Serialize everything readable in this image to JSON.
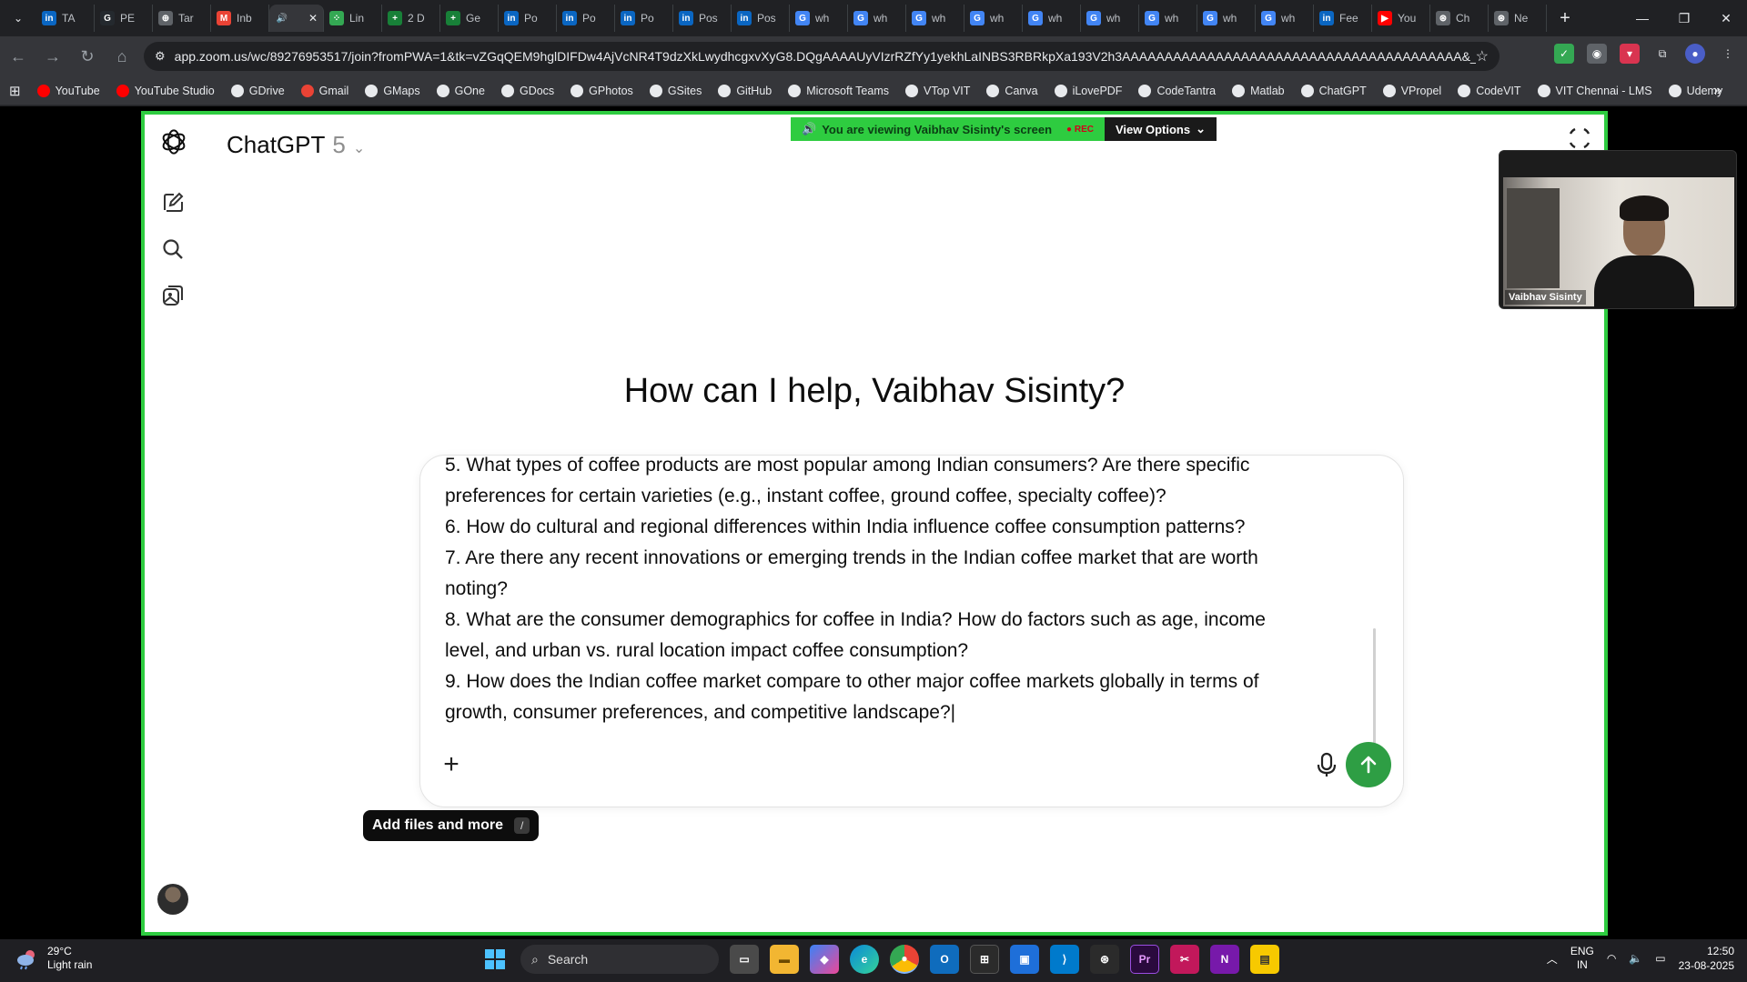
{
  "browser": {
    "tabs": [
      {
        "label": "TA",
        "icon": "linkedin-icon",
        "color": "#0a66c2",
        "glyph": "in"
      },
      {
        "label": "PE",
        "icon": "github-icon",
        "color": "#24292e",
        "glyph": "G"
      },
      {
        "label": "Tar",
        "icon": "globe-icon",
        "color": "#5f6368",
        "glyph": "⊕"
      },
      {
        "label": "Inb",
        "icon": "gmail-icon",
        "color": "#ea4335",
        "glyph": "M"
      },
      {
        "label": "",
        "icon": "audio-icon",
        "color": "#35363a",
        "glyph": "🔊",
        "active": true
      },
      {
        "label": "Lin",
        "icon": "grid-icon",
        "color": "#34a853",
        "glyph": "⁘"
      },
      {
        "label": "2 D",
        "icon": "sheets-icon",
        "color": "#188038",
        "glyph": "+"
      },
      {
        "label": "Ge",
        "icon": "sheets-icon",
        "color": "#188038",
        "glyph": "+"
      },
      {
        "label": "Po",
        "icon": "linkedin-icon",
        "color": "#0a66c2",
        "glyph": "in"
      },
      {
        "label": "Po",
        "icon": "linkedin-icon",
        "color": "#0a66c2",
        "glyph": "in"
      },
      {
        "label": "Po",
        "icon": "linkedin-icon",
        "color": "#0a66c2",
        "glyph": "in"
      },
      {
        "label": "Pos",
        "icon": "linkedin-icon",
        "color": "#0a66c2",
        "glyph": "in"
      },
      {
        "label": "Pos",
        "icon": "linkedin-icon",
        "color": "#0a66c2",
        "glyph": "in"
      },
      {
        "label": "wh",
        "icon": "google-icon",
        "color": "#4285f4",
        "glyph": "G"
      },
      {
        "label": "wh",
        "icon": "google-icon",
        "color": "#4285f4",
        "glyph": "G"
      },
      {
        "label": "wh",
        "icon": "google-icon",
        "color": "#4285f4",
        "glyph": "G"
      },
      {
        "label": "wh",
        "icon": "google-icon",
        "color": "#4285f4",
        "glyph": "G"
      },
      {
        "label": "wh",
        "icon": "google-icon",
        "color": "#4285f4",
        "glyph": "G"
      },
      {
        "label": "wh",
        "icon": "google-icon",
        "color": "#4285f4",
        "glyph": "G"
      },
      {
        "label": "wh",
        "icon": "google-icon",
        "color": "#4285f4",
        "glyph": "G"
      },
      {
        "label": "wh",
        "icon": "google-icon",
        "color": "#4285f4",
        "glyph": "G"
      },
      {
        "label": "wh",
        "icon": "google-icon",
        "color": "#4285f4",
        "glyph": "G"
      },
      {
        "label": "Fee",
        "icon": "linkedin-icon",
        "color": "#0a66c2",
        "glyph": "in"
      },
      {
        "label": "You",
        "icon": "youtube-icon",
        "color": "#ff0000",
        "glyph": "▶"
      },
      {
        "label": "Ch",
        "icon": "chatgpt-icon",
        "color": "#5f6368",
        "glyph": "⊛"
      },
      {
        "label": "Ne",
        "icon": "chatgpt-icon",
        "color": "#5f6368",
        "glyph": "⊛"
      }
    ],
    "url": "app.zoom.us/wc/89276953517/join?fromPWA=1&tk=vZGqQEM9hglDIFDw4AjVcNR4T9dzXkLwydhcgxvXyG8.DQgAAAAUyVIzrRZfYy1yekhLaINBS3RBRkpXa193V2h3AAAAAAAAAAAAAAAAAAAAAAAAAAAAAAAAAAAAAAAA&_x_zm_r...",
    "bookmarks": [
      "YouTube",
      "YouTube Studio",
      "GDrive",
      "Gmail",
      "GMaps",
      "GOne",
      "GDocs",
      "GPhotos",
      "GSites",
      "GitHub",
      "Microsoft Teams",
      "VTop VIT",
      "Canva",
      "iLovePDF",
      "CodeTantra",
      "Matlab",
      "ChatGPT",
      "VPropel",
      "CodeVIT",
      "VIT Chennai - LMS",
      "Udemy"
    ]
  },
  "zoom": {
    "banner_text": "You are viewing  Vaibhav Sisinty's screen",
    "rec_label": "REC",
    "view_options": "View Options",
    "participant_name": "Vaibhav Sisinty"
  },
  "chatgpt": {
    "model_name": "ChatGPT",
    "model_version": "5",
    "greeting": "How can I help, Vaibhav Sisinty?",
    "composer_lines": [
      "5. What types of coffee products are most popular among Indian consumers? Are there specific",
      "preferences for certain varieties (e.g., instant coffee, ground coffee, specialty coffee)?",
      "6. How do cultural and regional differences within India influence coffee consumption patterns?",
      "7. Are there any recent innovations or emerging trends in the Indian coffee market that are worth",
      "noting?",
      "8. What are the consumer demographics for coffee in India? How do factors such as age, income",
      "level, and urban vs. rural location impact coffee consumption?",
      "9. How does the Indian coffee market compare to other major coffee markets globally in terms of",
      "growth, consumer preferences, and competitive landscape?"
    ],
    "tooltip_label": "Add files and more",
    "tooltip_key": "/",
    "send_color": "#2e9e44"
  },
  "taskbar": {
    "temperature": "29°C",
    "weather": "Light rain",
    "search_placeholder": "Search",
    "lang_1": "ENG",
    "lang_2": "IN",
    "time": "12:50",
    "date": "23-08-2025"
  }
}
